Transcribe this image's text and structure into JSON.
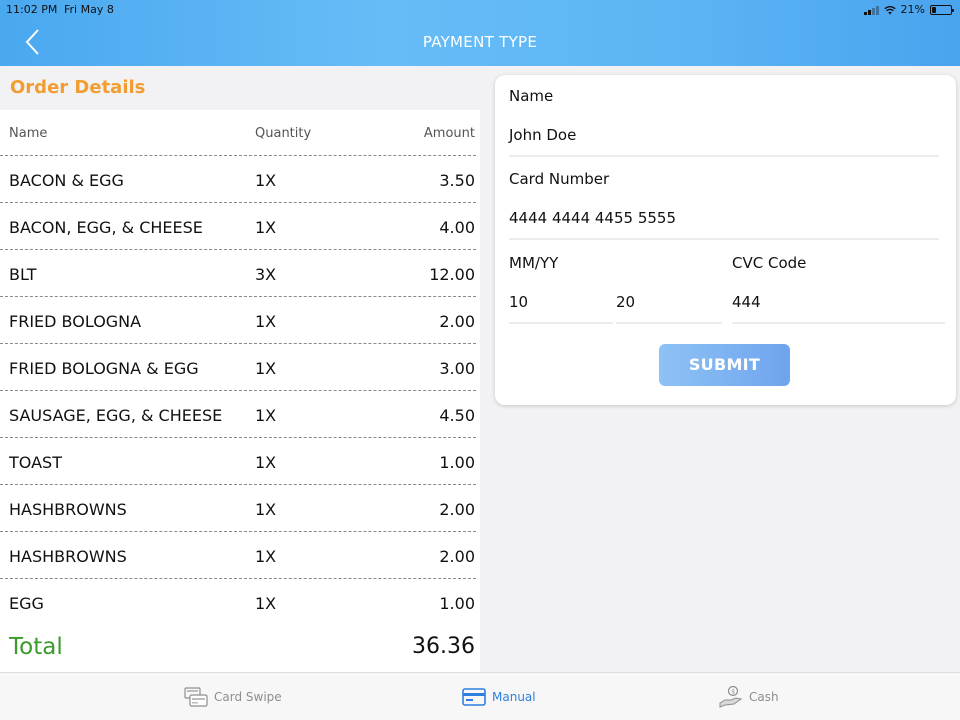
{
  "status": {
    "time": "11:02 PM",
    "date": "Fri May 8",
    "battery": "21%"
  },
  "nav": {
    "title": "PAYMENT TYPE",
    "back_icon": "chevron-left-icon"
  },
  "order": {
    "title": "Order Details",
    "columns": {
      "name": "Name",
      "quantity": "Quantity",
      "amount": "Amount"
    },
    "items": [
      {
        "name": "BACON & EGG",
        "qty": "1X",
        "amount": "3.50"
      },
      {
        "name": "BACON, EGG, & CHEESE",
        "qty": "1X",
        "amount": "4.00"
      },
      {
        "name": "BLT",
        "qty": "3X",
        "amount": "12.00"
      },
      {
        "name": "FRIED BOLOGNA",
        "qty": "1X",
        "amount": "2.00"
      },
      {
        "name": "FRIED BOLOGNA & EGG",
        "qty": "1X",
        "amount": "3.00"
      },
      {
        "name": "SAUSAGE, EGG, & CHEESE",
        "qty": "1X",
        "amount": "4.50"
      },
      {
        "name": "TOAST",
        "qty": "1X",
        "amount": "1.00"
      },
      {
        "name": "HASHBROWNS",
        "qty": "1X",
        "amount": "2.00"
      },
      {
        "name": "HASHBROWNS",
        "qty": "1X",
        "amount": "2.00"
      },
      {
        "name": "EGG",
        "qty": "1X",
        "amount": "1.00"
      }
    ],
    "total_label": "Total",
    "total_value": "36.36"
  },
  "form": {
    "name_label": "Name",
    "name_value": "John Doe",
    "card_label": "Card Number",
    "card_value": "4444 4444 4455 5555",
    "expiry_label": "MM/YY",
    "expiry_month": "10",
    "expiry_year": "20",
    "cvc_label": "CVC Code",
    "cvc_value": "444",
    "submit_label": "SUBMIT"
  },
  "tabs": [
    {
      "label": "Card Swipe",
      "icon": "card-swipe-icon",
      "active": false
    },
    {
      "label": "Manual",
      "icon": "credit-card-icon",
      "active": true
    },
    {
      "label": "Cash",
      "icon": "cash-hand-icon",
      "active": false
    }
  ],
  "colors": {
    "accent_orange": "#f29d2f",
    "total_green": "#3a9a2a",
    "active_blue": "#2f7fe0",
    "header_blue": "#5cb5f4"
  }
}
